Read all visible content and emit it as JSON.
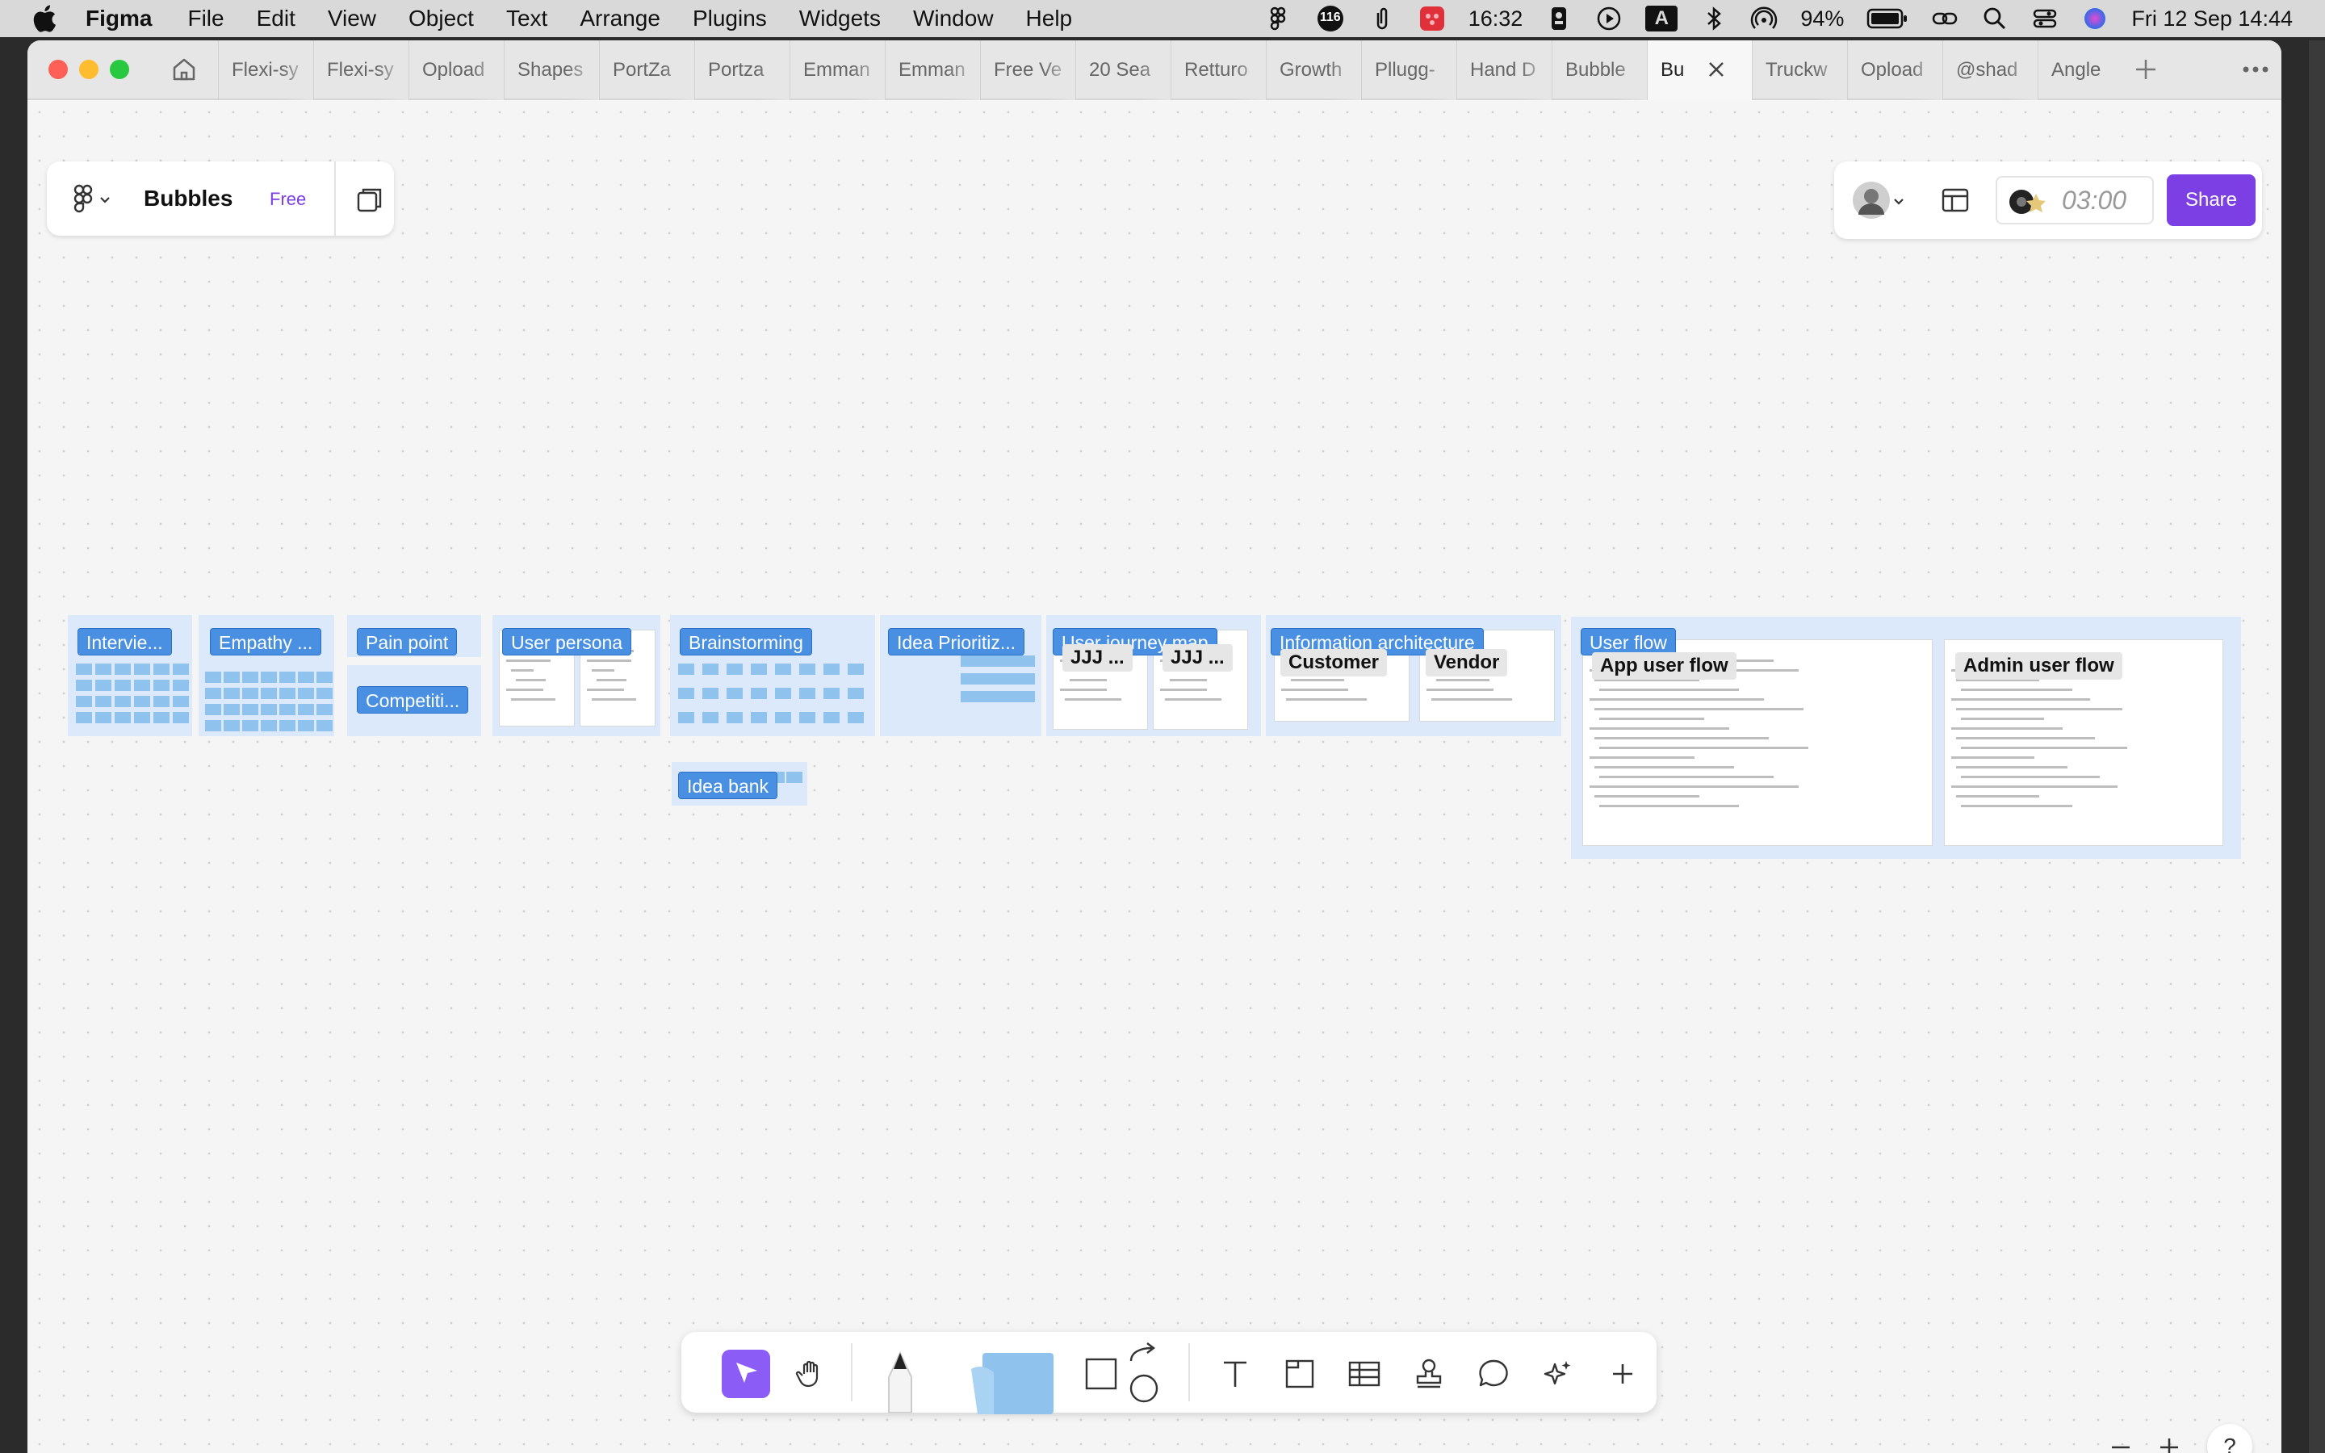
{
  "menubar": {
    "app_name": "Figma",
    "items": [
      "File",
      "Edit",
      "View",
      "Object",
      "Text",
      "Arrange",
      "Plugins",
      "Widgets",
      "Window",
      "Help"
    ],
    "badge_count": "116",
    "time_left": "16:32",
    "input_source": "A",
    "battery_percent": "94%",
    "clock": "Fri 12 Sep  14:44"
  },
  "tabs": {
    "items": [
      "Flexi-sy",
      "Flexi-sy",
      "Opload",
      "Shapes",
      "PortZa",
      "Portza",
      "Emman",
      "Emman",
      "Free Ve",
      "20 Sea",
      "Retturo",
      "Growth",
      "Pllugg-",
      "Hand D",
      "Bubble",
      "Bu",
      "Truckw",
      "Opload",
      "@shad",
      "Angle"
    ]
  },
  "file_header": {
    "file_name": "Bubbles",
    "plan_badge": "Free"
  },
  "top_right": {
    "timer": "03:00",
    "share_label": "Share"
  },
  "frames": {
    "interview": "Intervie...",
    "empathy": "Empathy ...",
    "pain_point": "Pain point",
    "competitive": "Competiti...",
    "user_persona": "User persona",
    "brainstorming": "Brainstorming",
    "idea_bank": "Idea bank",
    "idea_prioritization": "Idea Prioritiz...",
    "user_journey_map": "User journey map",
    "ujm_sub_1": "JJJ ...",
    "ujm_sub_2": "JJJ ...",
    "information_architecture": "Information architecture",
    "ia_customer": "Customer",
    "ia_vendor": "Vendor",
    "user_flow": "User flow",
    "app_user_flow": "App user flow",
    "admin_user_flow": "Admin user flow"
  },
  "zoom_controls": {
    "help_label": "?"
  },
  "colors": {
    "accent": "#7b3fe4",
    "frame_label_bg": "#4a90e2",
    "frame_bg": "#dbe9fa",
    "sticky": "#8fc3ee",
    "select_tool": "#8b5cf6"
  }
}
